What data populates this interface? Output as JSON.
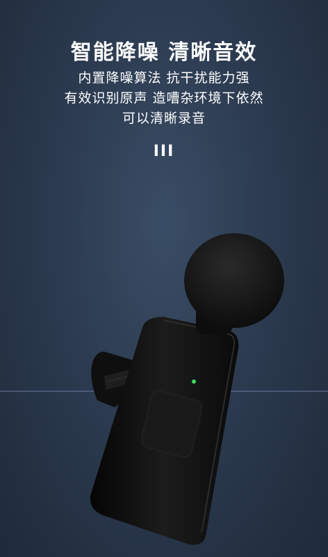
{
  "headline": "智能降噪  清晰音效",
  "description_lines": [
    "内置降噪算法  抗干扰能力强",
    "有效识别原声 造嘈杂环境下依然",
    "可以清晰录音"
  ],
  "divider_mark": "III",
  "colors": {
    "background_center": "#3a4d66",
    "background_edge": "#1f2a3a",
    "wave_left": "#e08a9a",
    "wave_right": "#8f86e8",
    "indicator_led": "#2fe05a"
  }
}
